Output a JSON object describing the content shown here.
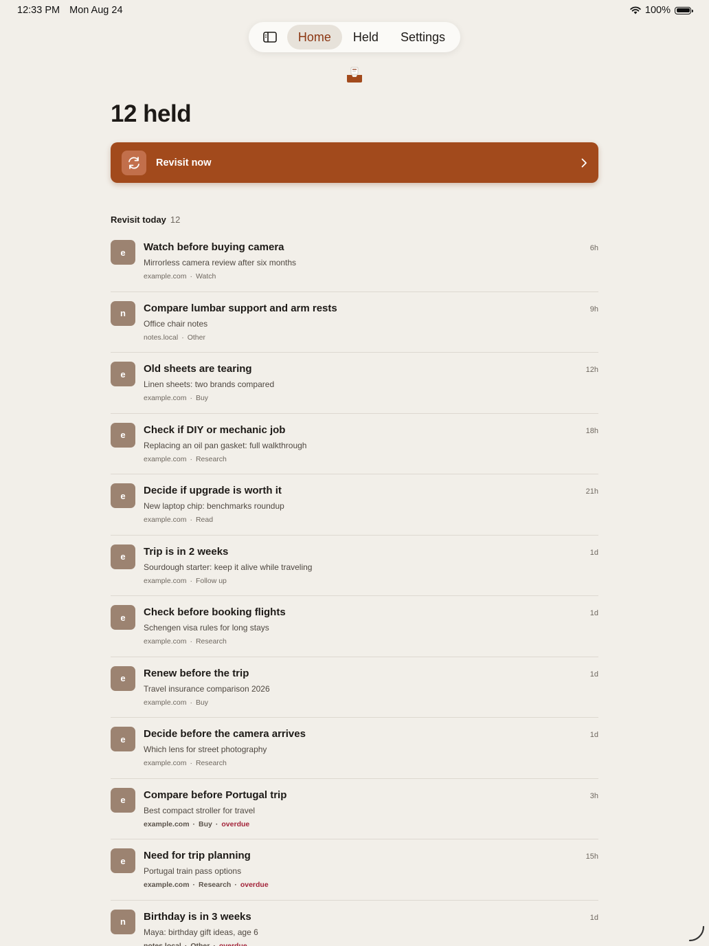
{
  "status": {
    "time": "12:33 PM",
    "date": "Mon Aug 24",
    "battery": "100%"
  },
  "nav": {
    "tabs": [
      "Home",
      "Held",
      "Settings"
    ],
    "active": "Home"
  },
  "page": {
    "title": "12 held"
  },
  "revisit": {
    "label": "Revisit now"
  },
  "section": {
    "label": "Revisit today",
    "count": "12"
  },
  "colors": {
    "accent": "#a24a1c",
    "avatar": "#9c8371",
    "overdue": "#a3243a",
    "background": "#f2efe9"
  },
  "items": [
    {
      "avatar": "e",
      "title": "Watch before buying camera",
      "subtitle": "Mirrorless camera review after six months",
      "source": "example.com",
      "category": "Watch",
      "overdue": "",
      "age": "6h"
    },
    {
      "avatar": "n",
      "title": "Compare lumbar support and arm rests",
      "subtitle": "Office chair notes",
      "source": "notes.local",
      "category": "Other",
      "overdue": "",
      "age": "9h"
    },
    {
      "avatar": "e",
      "title": "Old sheets are tearing",
      "subtitle": "Linen sheets: two brands compared",
      "source": "example.com",
      "category": "Buy",
      "overdue": "",
      "age": "12h"
    },
    {
      "avatar": "e",
      "title": "Check if DIY or mechanic job",
      "subtitle": "Replacing an oil pan gasket: full walkthrough",
      "source": "example.com",
      "category": "Research",
      "overdue": "",
      "age": "18h"
    },
    {
      "avatar": "e",
      "title": "Decide if upgrade is worth it",
      "subtitle": "New laptop chip: benchmarks roundup",
      "source": "example.com",
      "category": "Read",
      "overdue": "",
      "age": "21h"
    },
    {
      "avatar": "e",
      "title": "Trip is in 2 weeks",
      "subtitle": "Sourdough starter: keep it alive while traveling",
      "source": "example.com",
      "category": "Follow up",
      "overdue": "",
      "age": "1d"
    },
    {
      "avatar": "e",
      "title": "Check before booking flights",
      "subtitle": "Schengen visa rules for long stays",
      "source": "example.com",
      "category": "Research",
      "overdue": "",
      "age": "1d"
    },
    {
      "avatar": "e",
      "title": "Renew before the trip",
      "subtitle": "Travel insurance comparison 2026",
      "source": "example.com",
      "category": "Buy",
      "overdue": "",
      "age": "1d"
    },
    {
      "avatar": "e",
      "title": "Decide before the camera arrives",
      "subtitle": "Which lens for street photography",
      "source": "example.com",
      "category": "Research",
      "overdue": "",
      "age": "1d"
    },
    {
      "avatar": "e",
      "title": "Compare before Portugal trip",
      "subtitle": "Best compact stroller for travel",
      "source": "example.com",
      "category": "Buy",
      "overdue": "overdue",
      "age": "3h"
    },
    {
      "avatar": "e",
      "title": "Need for trip planning",
      "subtitle": "Portugal train pass options",
      "source": "example.com",
      "category": "Research",
      "overdue": "overdue",
      "age": "15h"
    },
    {
      "avatar": "n",
      "title": "Birthday is in 3 weeks",
      "subtitle": "Maya: birthday gift ideas, age 6",
      "source": "notes.local",
      "category": "Other",
      "overdue": "overdue",
      "age": "1d"
    }
  ]
}
